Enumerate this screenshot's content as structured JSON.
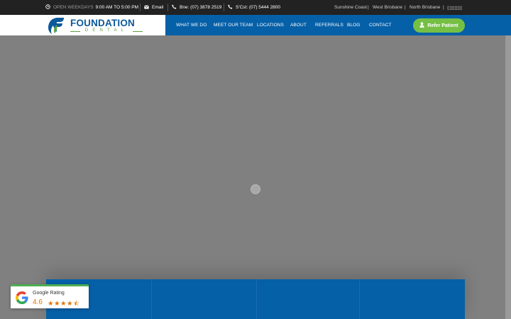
{
  "topbar": {
    "hours_prefix": "OPEN WEEKDAYS",
    "hours_value": "9:00 AM TO 5:00 PM",
    "email_label": "Email",
    "phone_bne": "Bne: (07) 3878 2519",
    "phone_scst": "S'Cst: (07) 5444 2800",
    "locations": [
      "Sunshine Coast",
      "West Brisbane",
      "North Brisbane"
    ],
    "locale_label": "▯▯▯▯▯▯"
  },
  "logo": {
    "word": "FOUNDATION",
    "sub": "DENTAL"
  },
  "nav": {
    "items": [
      "WHAT WE DO",
      "MEET OUR TEAM",
      "LOCATIONS",
      "ABOUT",
      "REFERRALS",
      "BLOG",
      "CONTACT"
    ],
    "cta_label": "Refer Patient"
  },
  "rating": {
    "label": "Google Rating",
    "score": "4.6",
    "stars": "★★★★⯪"
  },
  "colors": {
    "nav_blue": "#0560a8",
    "cta_green": "#76bf45",
    "topbar_bg": "#222222",
    "star_orange": "#e37400"
  },
  "icons": {
    "hours": "clock-icon",
    "email": "envelope-icon",
    "phone": "phone-icon",
    "cta": "user-icon"
  }
}
